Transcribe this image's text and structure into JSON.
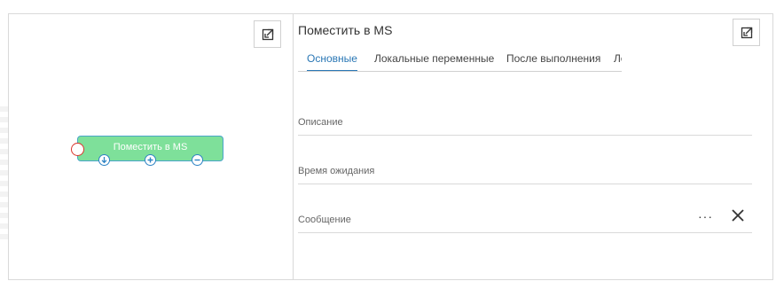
{
  "node": {
    "label": "Поместить в MS"
  },
  "panel": {
    "title": "Поместить в MS",
    "tabs": [
      {
        "label": "Основные",
        "active": true
      },
      {
        "label": "Локальные переменные",
        "active": false
      },
      {
        "label": "После выполнения",
        "active": false
      },
      {
        "label": "Лог",
        "active": false
      }
    ],
    "fields": [
      {
        "label": "Описание",
        "value": ""
      },
      {
        "label": "Время ожидания",
        "value": ""
      },
      {
        "label": "Сообщение",
        "value": ""
      }
    ],
    "more_glyph": "···"
  },
  "colors": {
    "node_fill": "#7ee09a",
    "node_border": "#4aa5c9",
    "active_tab": "#2a77b5",
    "input_port": "#d9342b"
  },
  "icons": [
    "expand-icon",
    "download-icon",
    "plus-icon",
    "minus-icon",
    "close-icon"
  ]
}
